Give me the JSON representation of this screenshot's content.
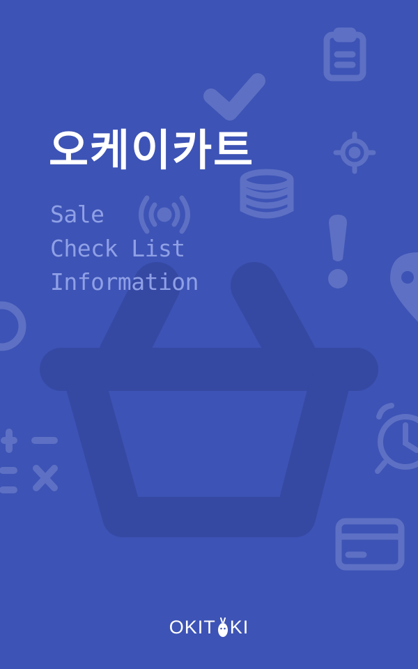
{
  "app": {
    "title": "오케이카트",
    "features": [
      "Sale",
      "Check List",
      "Information"
    ]
  },
  "brand": {
    "text_before": "OKIT",
    "text_after": "KI",
    "mascot_icon": "carrot-icon"
  },
  "colors": {
    "background": "#3d53b5",
    "icon_faint": "#5d70c4",
    "basket": "#3549a3",
    "title": "#ffffff",
    "feature_text": "#8fa0e6",
    "brand": "#ffffff"
  },
  "decorative_icons": [
    "clipboard-icon",
    "check-icon",
    "target-icon",
    "coins-icon",
    "broadcast-icon",
    "exclamation-icon",
    "location-pin-icon",
    "circle-icon",
    "shopping-basket-icon",
    "calculator-icon",
    "alarm-clock-icon",
    "credit-card-icon"
  ]
}
